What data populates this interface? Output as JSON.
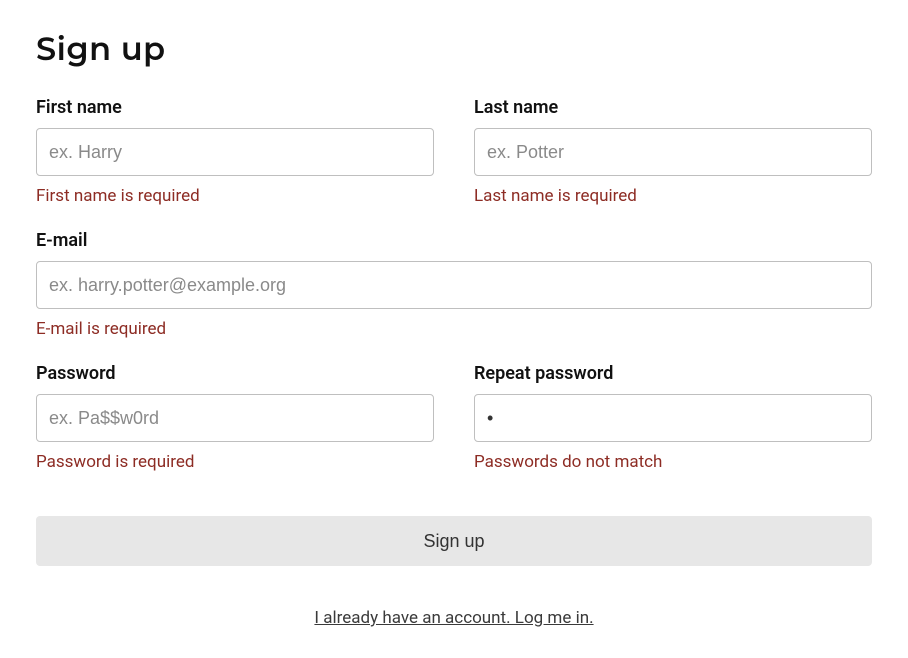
{
  "title": "Sign up",
  "form": {
    "first_name": {
      "label": "First name",
      "placeholder": "ex. Harry",
      "value": "",
      "error": "First name is required"
    },
    "last_name": {
      "label": "Last name",
      "placeholder": "ex. Potter",
      "value": "",
      "error": "Last name is required"
    },
    "email": {
      "label": "E-mail",
      "placeholder": "ex. harry.potter@example.org",
      "value": "",
      "error": "E-mail is required"
    },
    "password": {
      "label": "Password",
      "placeholder": "ex. Pa$$w0rd",
      "value": "",
      "error": "Password is required"
    },
    "repeat_password": {
      "label": "Repeat password",
      "placeholder": "",
      "value": "x",
      "error": "Passwords do not match"
    },
    "submit_label": "Sign up",
    "login_link": "I already have an account. Log me in."
  }
}
